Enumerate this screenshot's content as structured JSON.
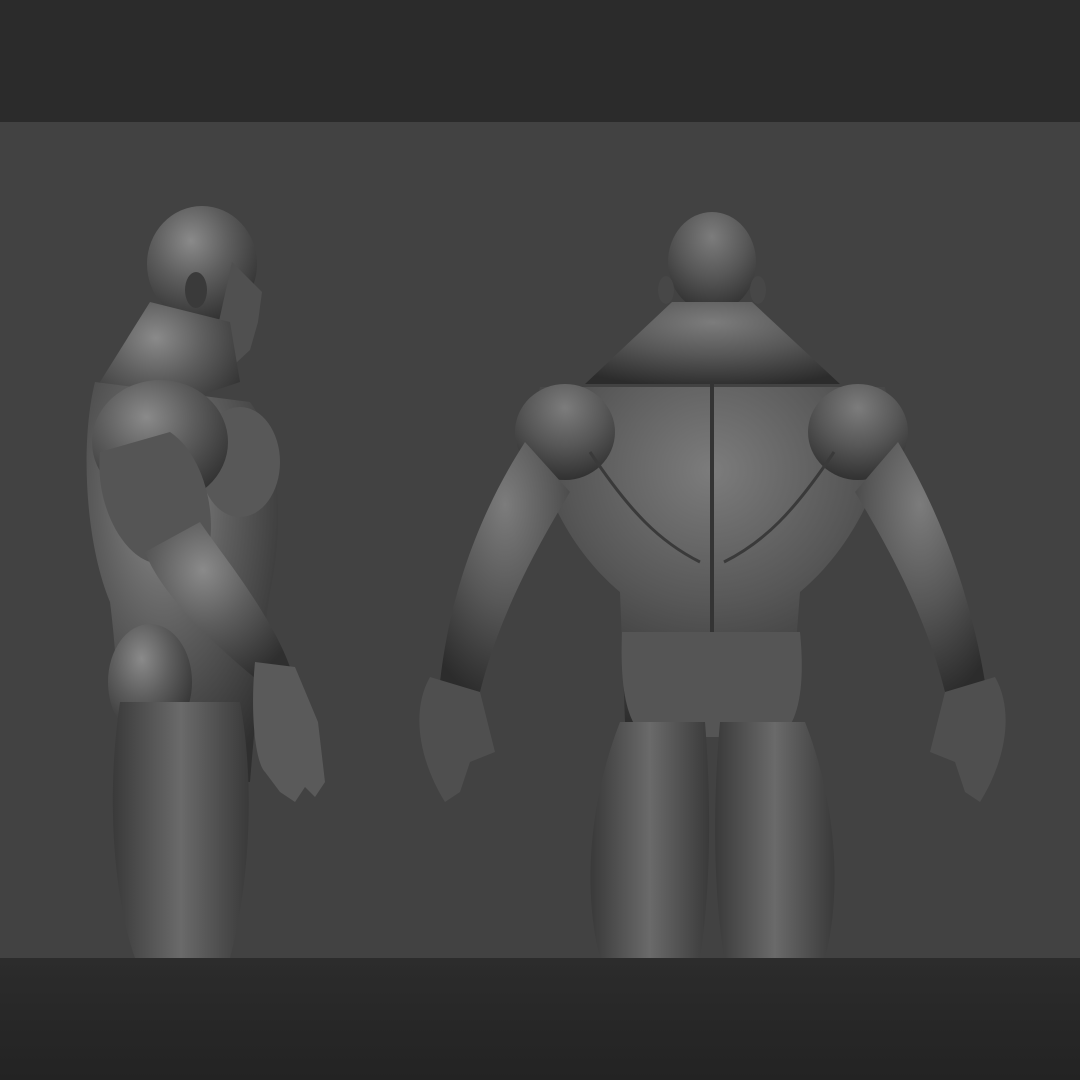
{
  "scene": {
    "views": [
      {
        "name": "side-view"
      },
      {
        "name": "back-view"
      }
    ],
    "colors": {
      "frame": "#2a2a2a",
      "viewport": "#424242",
      "clay": "#5e5e5e",
      "clay_highlight": "#8a8a8a",
      "clay_shadow": "#2f2f2f"
    }
  }
}
